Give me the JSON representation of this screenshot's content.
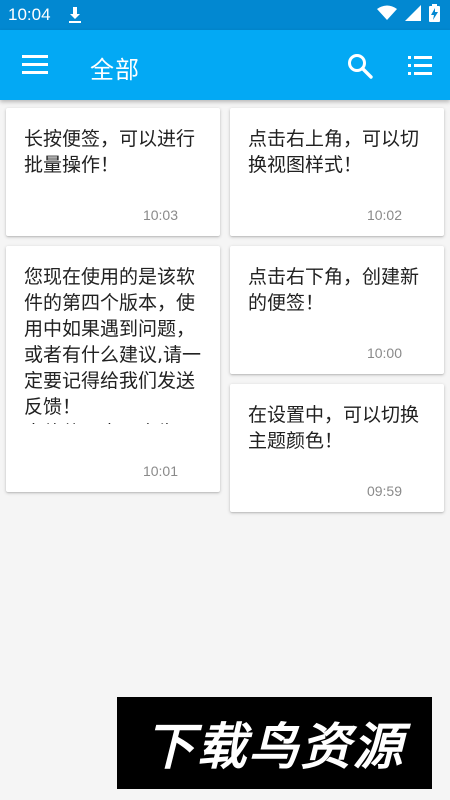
{
  "status_bar": {
    "time": "10:04",
    "icons": [
      "download-icon",
      "wifi-icon",
      "signal-icon",
      "battery-charging-icon"
    ]
  },
  "app_bar": {
    "title": "全部",
    "icons": [
      "menu-icon",
      "search-icon",
      "list-view-icon"
    ],
    "background_color": "#03a9f4"
  },
  "notes": [
    {
      "text": "长按便签，可以进行批量操作！",
      "time": "10:03"
    },
    {
      "text": "点击右上角，可以切换视图样式！",
      "time": "10:02"
    },
    {
      "text": "您现在使用的是该软件的第四个版本，使用中如果遇到问题，或者有什么建议,请一定要记得给我们发送反馈！\n本软件无毒无广告…",
      "time": "10:01"
    },
    {
      "text": "点击右下角，创建新的便签！",
      "time": "10:00"
    },
    {
      "text": "在设置中，可以切换主题颜色！",
      "time": "09:59"
    }
  ],
  "watermark": {
    "text": "下载鸟资源"
  }
}
